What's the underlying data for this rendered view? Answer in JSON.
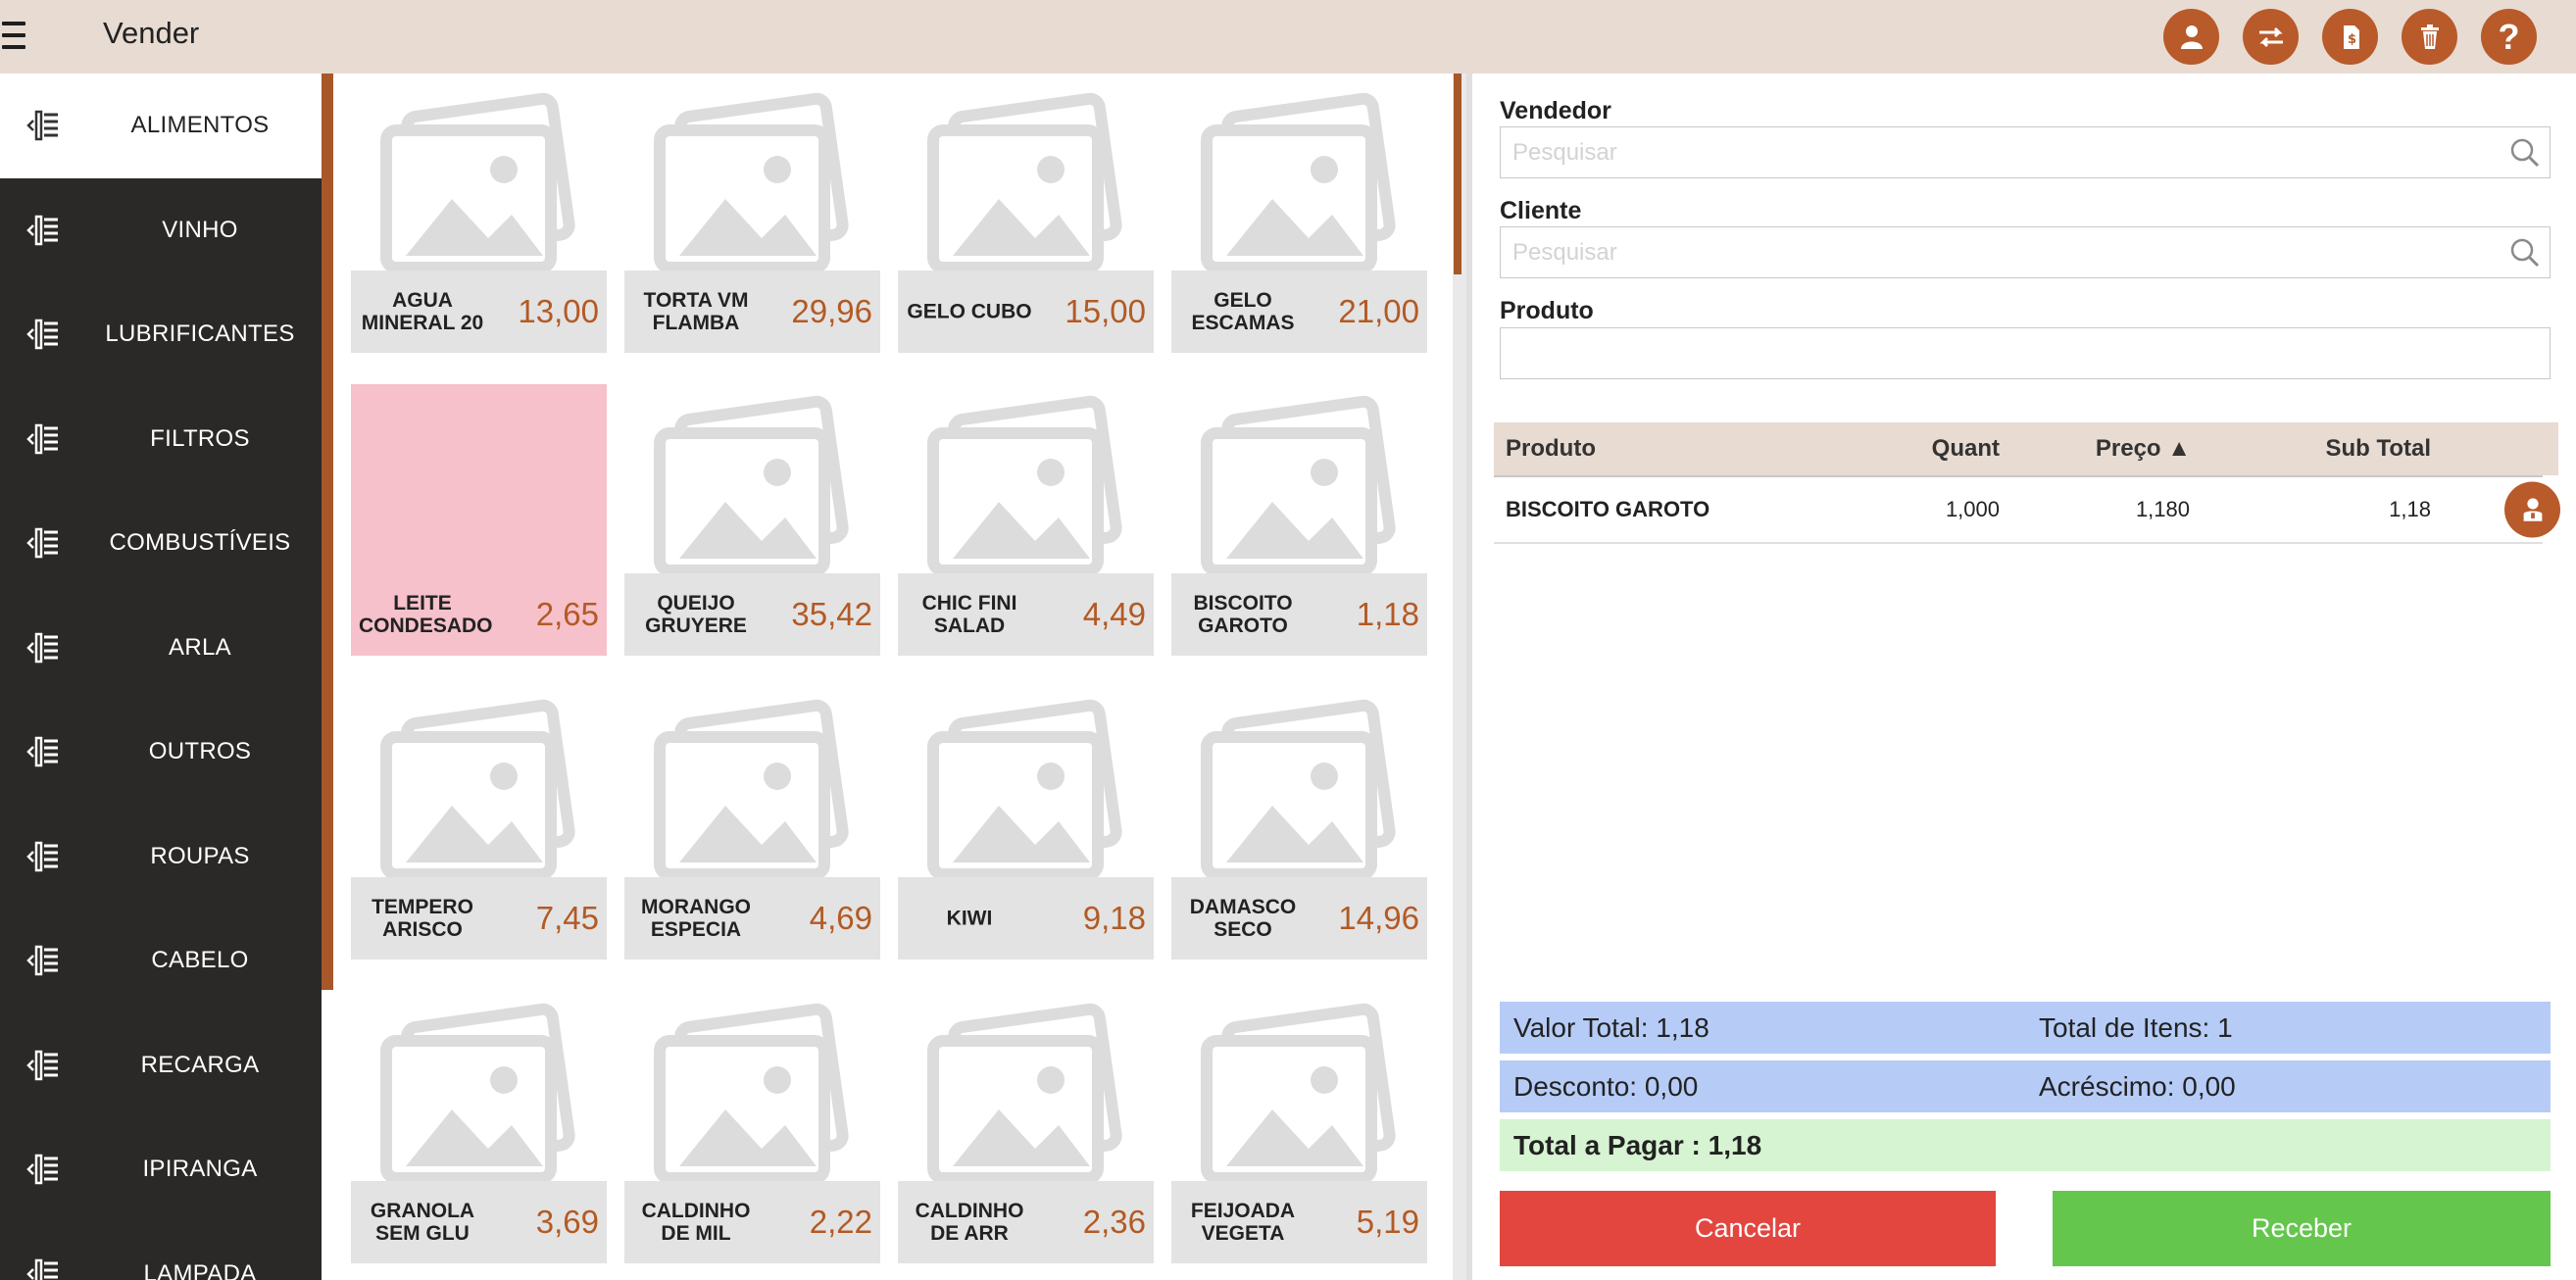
{
  "app": {
    "title": "Vender"
  },
  "toolbar": {
    "buttons": [
      "user-icon",
      "transfer-icon",
      "document-icon",
      "trash-icon",
      "help-icon"
    ],
    "help_label": "?"
  },
  "colors": {
    "accent": "#b85a2a",
    "header": "#e8dbd2",
    "sidebar": "#2a2927",
    "cancel": "#e2463f",
    "receive": "#64c64d",
    "summary_blue": "#b6ccf7",
    "summary_green": "#d7f4d2",
    "highlight_card": "#f6c1cb"
  },
  "sidebar": {
    "categories": [
      {
        "label": "ALIMENTOS",
        "active": true
      },
      {
        "label": "VINHO"
      },
      {
        "label": "LUBRIFICANTES"
      },
      {
        "label": "FILTROS"
      },
      {
        "label": "COMBUSTÍVEIS"
      },
      {
        "label": "ARLA"
      },
      {
        "label": "OUTROS"
      },
      {
        "label": "ROUPAS"
      },
      {
        "label": "CABELO"
      },
      {
        "label": "RECARGA"
      },
      {
        "label": "IPIRANGA"
      },
      {
        "label": "LAMPADA"
      }
    ]
  },
  "products": [
    {
      "name": "AGUA MINERAL 20",
      "price": "13,00"
    },
    {
      "name": "TORTA VM FLAMBA",
      "price": "29,96"
    },
    {
      "name": "GELO CUBO",
      "price": "15,00"
    },
    {
      "name": "GELO ESCAMAS",
      "price": "21,00"
    },
    {
      "name": "LEITE CONDESADO",
      "price": "2,65",
      "highlighted": true
    },
    {
      "name": "QUEIJO GRUYERE",
      "price": "35,42"
    },
    {
      "name": "CHIC FINI SALAD",
      "price": "4,49"
    },
    {
      "name": "BISCOITO GAROTO",
      "price": "1,18"
    },
    {
      "name": "TEMPERO ARISCO",
      "price": "7,45"
    },
    {
      "name": "MORANGO ESPECIA",
      "price": "4,69"
    },
    {
      "name": "KIWI",
      "price": "9,18"
    },
    {
      "name": "DAMASCO SECO",
      "price": "14,96"
    },
    {
      "name": "GRANOLA SEM GLU",
      "price": "3,69"
    },
    {
      "name": "CALDINHO DE MIL",
      "price": "2,22"
    },
    {
      "name": "CALDINHO DE ARR",
      "price": "2,36"
    },
    {
      "name": "FEIJOADA VEGETA",
      "price": "5,19"
    }
  ],
  "form": {
    "seller_label": "Vendedor",
    "seller_placeholder": "Pesquisar",
    "seller_value": "",
    "client_label": "Cliente",
    "client_placeholder": "Pesquisar",
    "client_value": "",
    "product_label": "Produto",
    "product_value": ""
  },
  "cart": {
    "columns": {
      "product": "Produto",
      "qty": "Quant",
      "price": "Preço ▲",
      "subtotal": "Sub Total"
    },
    "rows": [
      {
        "product": "BISCOITO GAROTO",
        "qty": "1,000",
        "price": "1,180",
        "subtotal": "1,18"
      }
    ]
  },
  "summary": {
    "total_value": "Valor Total: 1,18",
    "total_items": "Total de Itens: 1",
    "discount": "Desconto: 0,00",
    "surcharge": "Acréscimo: 0,00",
    "to_pay": "Total a Pagar : 1,18"
  },
  "actions": {
    "cancel_label": "Cancelar",
    "receive_label": "Receber"
  }
}
